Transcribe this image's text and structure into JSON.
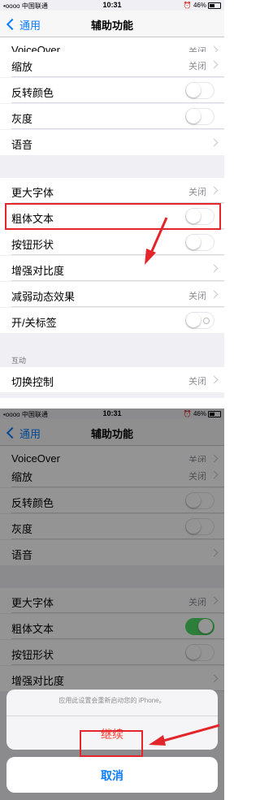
{
  "status": {
    "carrier": "•oooo 中国联通",
    "time": "10:31",
    "battery": "46%"
  },
  "nav": {
    "back": "通用",
    "title": "辅助功能"
  },
  "rows": {
    "voiceover": {
      "label": "VoiceOver",
      "value": "关闭"
    },
    "zoom": {
      "label": "缩放",
      "value": "关闭"
    },
    "invert": {
      "label": "反转颜色"
    },
    "gray": {
      "label": "灰度"
    },
    "speech": {
      "label": "语音"
    },
    "larger": {
      "label": "更大字体",
      "value": "关闭"
    },
    "bold": {
      "label": "粗体文本"
    },
    "shapes": {
      "label": "按钮形状"
    },
    "contrast": {
      "label": "增强对比度"
    },
    "motion": {
      "label": "减弱动态效果",
      "value": "关闭"
    },
    "onoff": {
      "label": "开/关标签"
    },
    "switch_ctrl": {
      "label": "切换控制",
      "value": "关闭"
    }
  },
  "section_interaction": "互动",
  "alert": {
    "message": "应用此设置会重新启动您的 iPhone。",
    "continue": "继续",
    "cancel": "取消"
  },
  "toggles_top": {
    "invert": false,
    "gray": false,
    "bold": false,
    "shapes": false,
    "onoff": false
  },
  "toggles_bottom": {
    "bold": true
  },
  "colors": {
    "accent": "#0a7cff",
    "toggle_on": "#4cd964",
    "highlight": "#e3262b",
    "destructive": "#ff3b30"
  }
}
